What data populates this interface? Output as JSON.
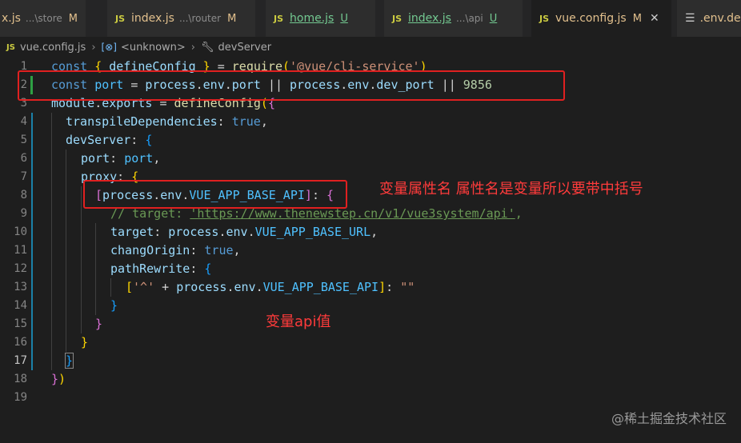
{
  "tabs": [
    {
      "name": "x.js",
      "path": "...\\store",
      "badge": "M"
    },
    {
      "name": "index.js",
      "path": "...\\router",
      "badge": "M"
    },
    {
      "name": "home.js",
      "path": "",
      "badge": "U"
    },
    {
      "name": "index.js",
      "path": "...\\api",
      "badge": "U"
    },
    {
      "name": "vue.config.js",
      "path": "",
      "badge": "M"
    },
    {
      "name": ".env.dev",
      "path": "",
      "badge": ""
    }
  ],
  "js_icon": "JS",
  "close_glyph": "✕",
  "breadcrumb": {
    "file": "vue.config.js",
    "symbol": "<unknown>",
    "prop": "devServer"
  },
  "line_numbers": [
    "1",
    "2",
    "3",
    "4",
    "5",
    "6",
    "7",
    "8",
    "9",
    "10",
    "11",
    "12",
    "13",
    "14",
    "15",
    "16",
    "17",
    "18",
    "19"
  ],
  "code": {
    "l1": [
      "const",
      "{",
      "defineConfig",
      "}",
      "=",
      "require",
      "(",
      "'@vue/cli-service'",
      ")"
    ],
    "l2": [
      "const",
      "port",
      "=",
      "process",
      "env",
      "port",
      "||",
      "process",
      "env",
      "dev_port",
      "||",
      "9856"
    ],
    "l3": [
      "module",
      "exports",
      "=",
      "defineConfig",
      "(",
      "{"
    ],
    "l4": [
      "transpileDependencies",
      ":",
      "true",
      ","
    ],
    "l5": [
      "devServer",
      ":",
      "{"
    ],
    "l6": [
      "port",
      ":",
      "port",
      ","
    ],
    "l7": [
      "proxy",
      ":",
      "{"
    ],
    "l8": [
      "[",
      "process",
      "env",
      "VUE_APP_BASE_API",
      "]",
      ":",
      "{"
    ],
    "l9": [
      "// target: ",
      "'https://www.thenewstep.cn/v1/vue3system/api'",
      ","
    ],
    "l10": [
      "target",
      ":",
      "process",
      "env",
      "VUE_APP_BASE_URL",
      ","
    ],
    "l11": [
      "changOrigin",
      ":",
      "true",
      ","
    ],
    "l12": [
      "pathRewrite",
      ":",
      "{"
    ],
    "l13": [
      "[",
      "'^'",
      "+",
      "process",
      "env",
      "VUE_APP_BASE_API",
      "]",
      ":",
      "\"\""
    ],
    "l14": [
      "}"
    ],
    "l15": [
      "}"
    ],
    "l16": [
      "}"
    ],
    "l17": [
      "}"
    ],
    "l18": [
      "}",
      ")"
    ]
  },
  "annotations": {
    "a1": "变量属性名 属性名是变量所以要带中括号",
    "a2": "变量api值"
  },
  "watermark": "@稀土掘金技术社区",
  "colors": {
    "annotation": "#ff3b3b",
    "editor_bg": "#1e1e1e",
    "keyword": "#569cd6",
    "string": "#ce9178"
  }
}
